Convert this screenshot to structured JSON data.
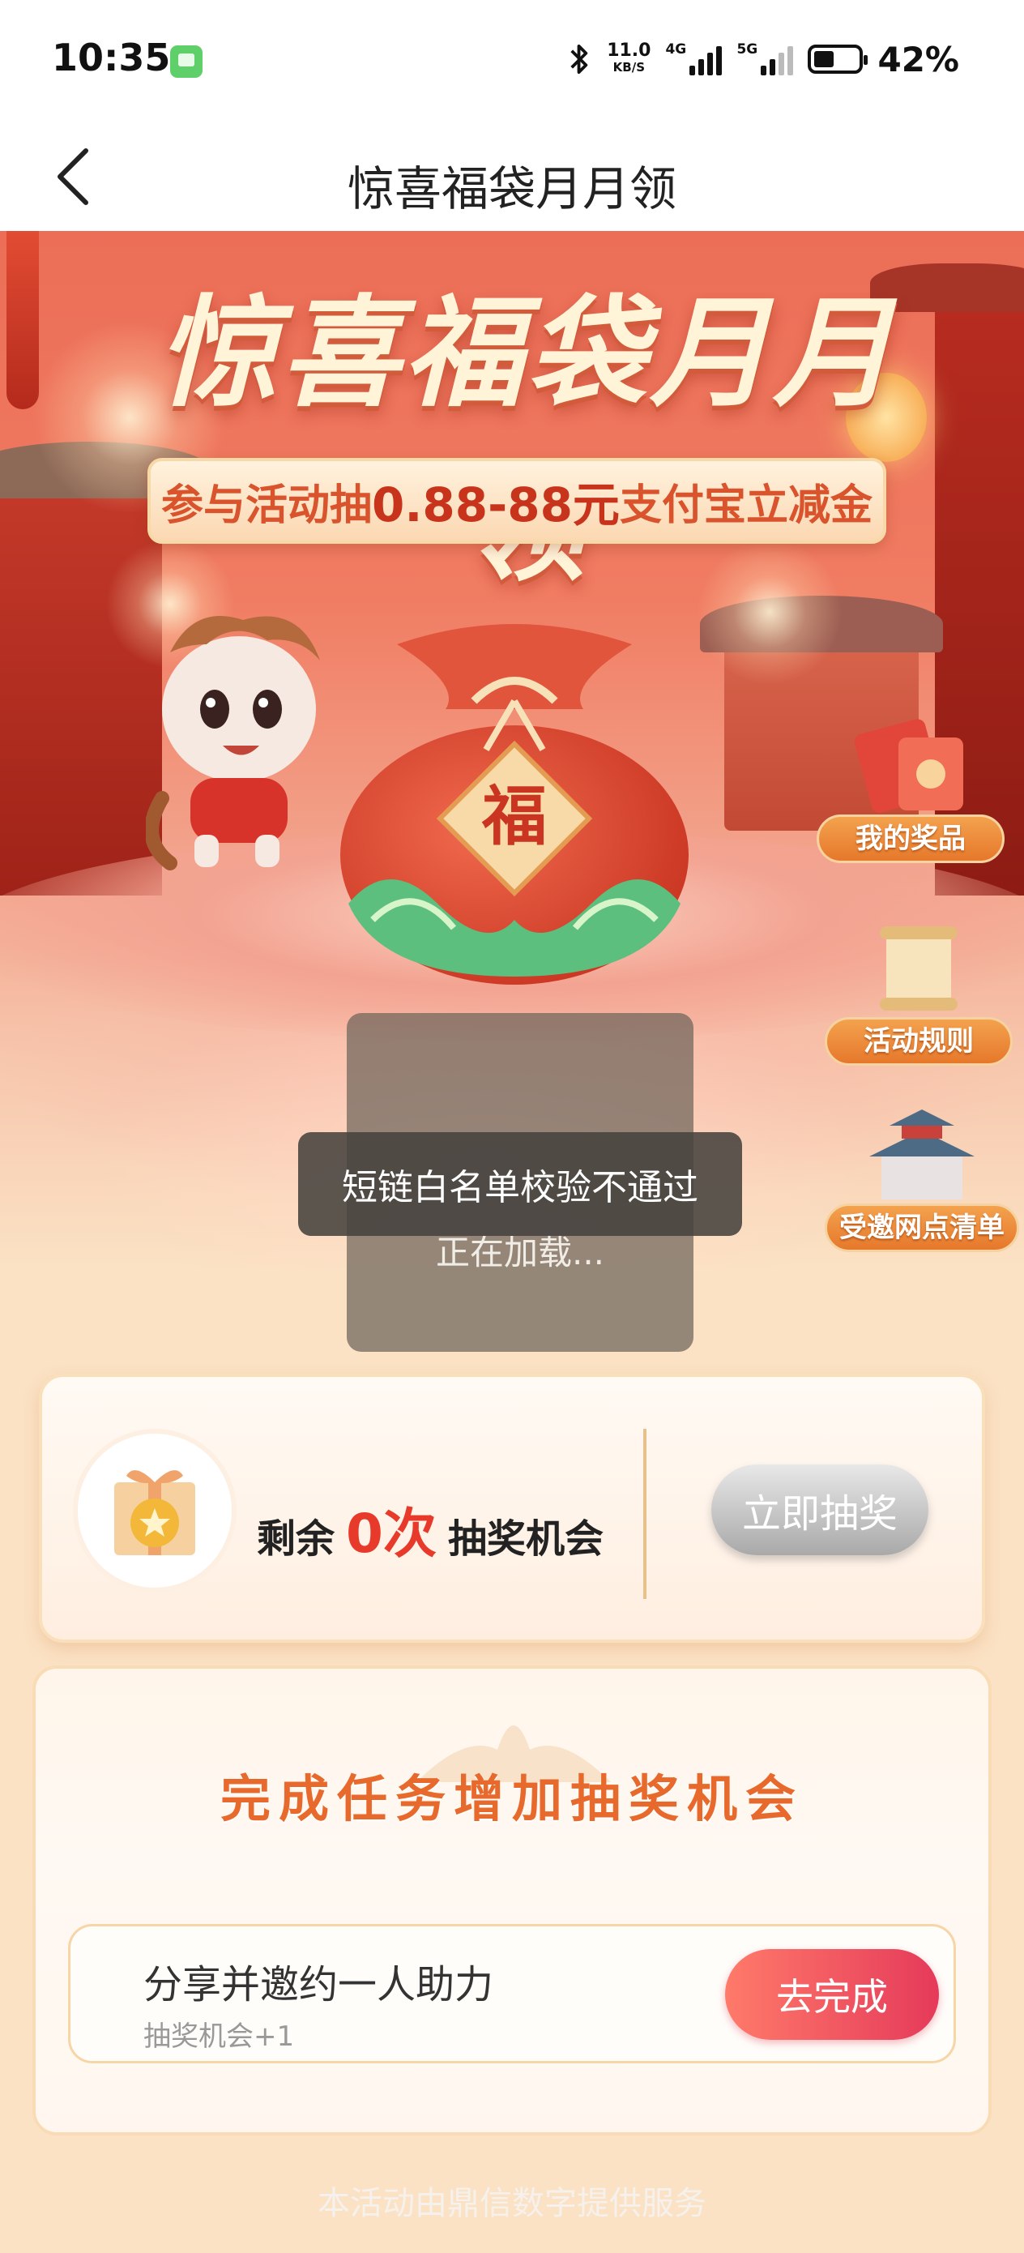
{
  "status_bar": {
    "time": "10:35",
    "net_speed": "11.0",
    "net_speed_unit": "KB/S",
    "network_1": "4G",
    "network_2": "5G",
    "battery": "42%"
  },
  "nav": {
    "title": "惊喜福袋月月领",
    "back_icon": "chevron-left-icon"
  },
  "banner": {
    "title": "惊喜福袋月月领",
    "subtitle_prefix": "参与活动抽",
    "subtitle_amount": "0.88-88元",
    "subtitle_suffix": "支付宝立减金",
    "bag_char": "福",
    "side_buttons": [
      {
        "label": "我的奖品",
        "icon": "red-envelope-icon"
      },
      {
        "label": "活动规则",
        "icon": "scroll-icon"
      },
      {
        "label": "受邀网点清单",
        "icon": "pavilion-icon"
      }
    ]
  },
  "overlay": {
    "toast": "短链白名单校验不通过",
    "loading": "正在加载..."
  },
  "lottery": {
    "prefix": "剩余",
    "count": "0次",
    "suffix": "抽奖机会",
    "button": "立即抽奖"
  },
  "tasks": {
    "heading": "完成任务增加抽奖机会",
    "items": [
      {
        "name": "分享并邀约一人助力",
        "reward": "抽奖机会+1",
        "button": "去完成"
      }
    ]
  },
  "footer": "本活动由鼎信数字提供服务",
  "colors": {
    "accent_red": "#e83a2a",
    "task_button": "#e53a5a",
    "heading_orange": "#e8692c"
  }
}
